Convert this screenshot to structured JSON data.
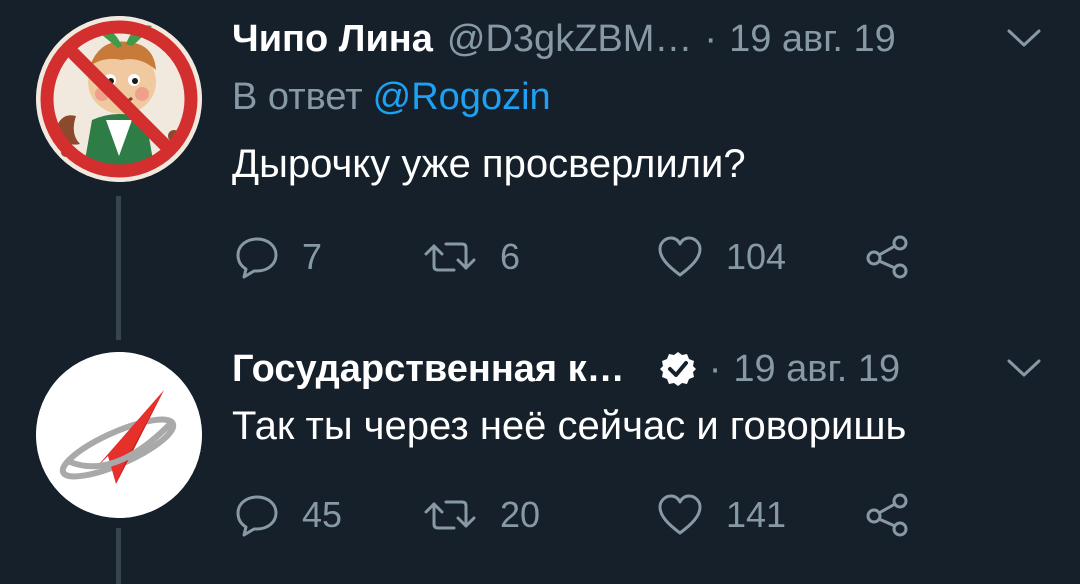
{
  "tweets": [
    {
      "display_name": "Чипо Лина",
      "handle": "@D3gkZBM…",
      "separator": "·",
      "date": "19 авг. 19",
      "reply_prefix": "В ответ",
      "reply_mention": "@Rogozin",
      "text": "Дырочку уже просверлили?",
      "replies": "7",
      "retweets": "6",
      "likes": "104",
      "avatar_icon": "crossed-out-cartoon-character-icon"
    },
    {
      "display_name": "Государственная к…",
      "verified": true,
      "separator": "·",
      "date": "19 авг. 19",
      "text": "Так ты через неё сейчас и говоришь",
      "replies": "45",
      "retweets": "20",
      "likes": "141",
      "avatar_icon": "roscosmos-logo-icon"
    }
  ],
  "icons": {
    "reply": "reply-icon",
    "retweet": "retweet-icon",
    "like": "heart-icon",
    "share": "share-icon",
    "menu": "chevron-down-icon",
    "verified": "verified-badge-icon"
  },
  "colors": {
    "background": "#15202b",
    "primary_text": "#ffffff",
    "secondary_text": "#8899a6",
    "link": "#1da1f2",
    "thread_line": "#38444d",
    "prohibition_red": "#d32f2f",
    "logo_red": "#e5302b"
  }
}
